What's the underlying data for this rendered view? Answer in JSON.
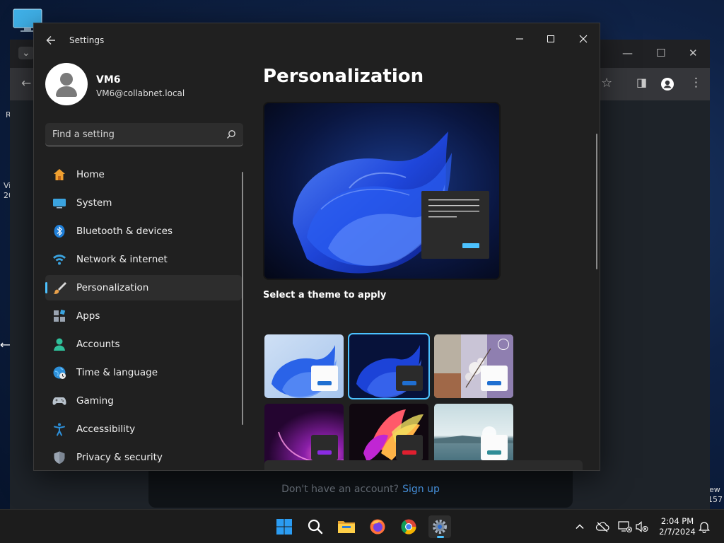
{
  "desktop": {
    "fragments": [
      "R",
      "Vi",
      "20",
      "ew",
      "157"
    ]
  },
  "browser": {
    "signup_text": "Don't have an account?",
    "signup_link": "Sign up"
  },
  "settings": {
    "app_title": "Settings",
    "user": {
      "name": "VM6",
      "email": "VM6@collabnet.local"
    },
    "search": {
      "placeholder": "Find a setting"
    },
    "nav": [
      {
        "label": "Home",
        "icon": "home-icon"
      },
      {
        "label": "System",
        "icon": "system-icon"
      },
      {
        "label": "Bluetooth & devices",
        "icon": "bluetooth-icon"
      },
      {
        "label": "Network & internet",
        "icon": "network-icon"
      },
      {
        "label": "Personalization",
        "icon": "personalization-icon",
        "active": true
      },
      {
        "label": "Apps",
        "icon": "apps-icon"
      },
      {
        "label": "Accounts",
        "icon": "accounts-icon"
      },
      {
        "label": "Time & language",
        "icon": "time-language-icon"
      },
      {
        "label": "Gaming",
        "icon": "gaming-icon"
      },
      {
        "label": "Accessibility",
        "icon": "accessibility-icon"
      },
      {
        "label": "Privacy & security",
        "icon": "privacy-security-icon"
      }
    ],
    "page_title": "Personalization",
    "theme_section_label": "Select a theme to apply",
    "themes": [
      {
        "name": "windows-light",
        "selected": false
      },
      {
        "name": "windows-dark",
        "selected": true
      },
      {
        "name": "flow-spotlight",
        "selected": false
      },
      {
        "name": "glow",
        "selected": false
      },
      {
        "name": "captured-motion",
        "selected": false
      },
      {
        "name": "sunrise",
        "selected": false
      }
    ],
    "accent_color": "#4cc2ff"
  },
  "taskbar": {
    "apps": [
      "start-icon",
      "search-icon",
      "file-explorer-icon",
      "firefox-icon",
      "chrome-icon",
      "settings-icon"
    ],
    "active_app": "settings-icon",
    "clock": {
      "time": "2:04 PM",
      "date": "2/7/2024"
    }
  }
}
